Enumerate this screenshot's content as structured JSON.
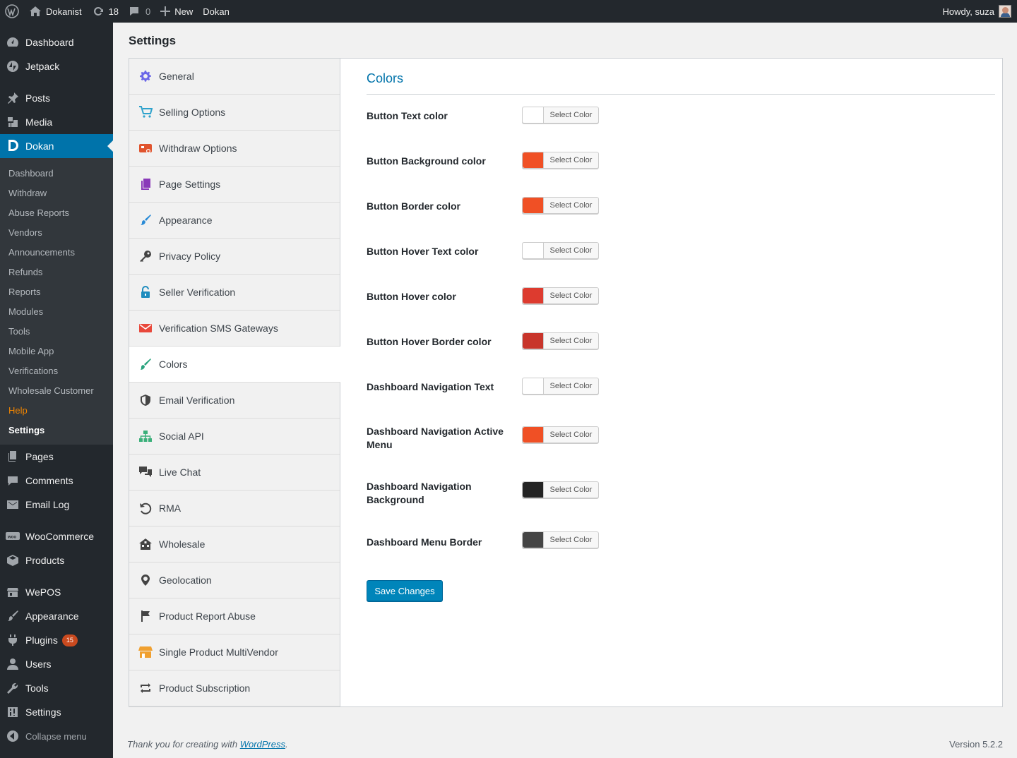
{
  "admin_bar": {
    "site_name": "Dokanist",
    "updates_count": "18",
    "comments_count": "0",
    "new_label": "New",
    "plugin_label": "Dokan",
    "greeting": "Howdy, suza"
  },
  "sidebar": {
    "top_items": [
      {
        "label": "Dashboard",
        "icon": "dashboard-icon"
      },
      {
        "label": "Jetpack",
        "icon": "jetpack-icon"
      },
      {
        "label": "Posts",
        "icon": "pin-icon"
      },
      {
        "label": "Media",
        "icon": "media-icon"
      },
      {
        "label": "Dokan",
        "icon": "dokan-icon"
      }
    ],
    "dokan_submenu": [
      "Dashboard",
      "Withdraw",
      "Abuse Reports",
      "Vendors",
      "Announcements",
      "Refunds",
      "Reports",
      "Modules",
      "Tools",
      "Mobile App",
      "Verifications",
      "Wholesale Customer",
      "Help",
      "Settings"
    ],
    "bottom_items": [
      {
        "label": "Pages",
        "icon": "pages-icon"
      },
      {
        "label": "Comments",
        "icon": "comment-icon"
      },
      {
        "label": "Email Log",
        "icon": "email-icon"
      },
      {
        "label": "WooCommerce",
        "icon": "woo-icon"
      },
      {
        "label": "Products",
        "icon": "box-icon"
      },
      {
        "label": "WePOS",
        "icon": "store-icon"
      },
      {
        "label": "Appearance",
        "icon": "brush-icon"
      },
      {
        "label": "Plugins",
        "icon": "plugin-icon",
        "badge": "15"
      },
      {
        "label": "Users",
        "icon": "user-icon"
      },
      {
        "label": "Tools",
        "icon": "wrench-icon"
      },
      {
        "label": "Settings",
        "icon": "settings-icon"
      }
    ],
    "collapse_label": "Collapse menu"
  },
  "page": {
    "title": "Settings"
  },
  "tabs": [
    {
      "label": "General",
      "icon": "gear-icon",
      "color": "#6b67e8"
    },
    {
      "label": "Selling Options",
      "icon": "cart-icon",
      "color": "#2ea2cc"
    },
    {
      "label": "Withdraw Options",
      "icon": "withdraw-icon",
      "color": "#e0542e"
    },
    {
      "label": "Page Settings",
      "icon": "pages-icon",
      "color": "#8a3ab9"
    },
    {
      "label": "Appearance",
      "icon": "brush-icon",
      "color": "#2a8bd6"
    },
    {
      "label": "Privacy Policy",
      "icon": "key-icon",
      "color": "#444444"
    },
    {
      "label": "Seller Verification",
      "icon": "lock-icon",
      "color": "#1e8cbe"
    },
    {
      "label": "Verification SMS Gateways",
      "icon": "envelope-icon",
      "color": "#e8483b"
    },
    {
      "label": "Colors",
      "icon": "paintbrush-icon",
      "color": "#2aa37e"
    },
    {
      "label": "Email Verification",
      "icon": "shield-icon",
      "color": "#444444"
    },
    {
      "label": "Social API",
      "icon": "network-icon",
      "color": "#3bb07a"
    },
    {
      "label": "Live Chat",
      "icon": "chat-icon",
      "color": "#444444"
    },
    {
      "label": "RMA",
      "icon": "undo-icon",
      "color": "#444444"
    },
    {
      "label": "Wholesale",
      "icon": "wholesale-icon",
      "color": "#444444"
    },
    {
      "label": "Geolocation",
      "icon": "location-icon",
      "color": "#444444"
    },
    {
      "label": "Product Report Abuse",
      "icon": "flag-icon",
      "color": "#444444"
    },
    {
      "label": "Single Product MultiVendor",
      "icon": "shop-icon",
      "color": "#f0a030"
    },
    {
      "label": "Product Subscription",
      "icon": "repeat-icon",
      "color": "#444444"
    }
  ],
  "active_tab": "Colors",
  "colors_section": {
    "title": "Colors",
    "select_label": "Select Color",
    "fields": [
      {
        "label": "Button Text color",
        "color": "#ffffff"
      },
      {
        "label": "Button Background color",
        "color": "#f05025"
      },
      {
        "label": "Button Border color",
        "color": "#f05025"
      },
      {
        "label": "Button Hover Text color",
        "color": "#ffffff"
      },
      {
        "label": "Button Hover color",
        "color": "#dd3b2f"
      },
      {
        "label": "Button Hover Border color",
        "color": "#c8352b"
      },
      {
        "label": "Dashboard Navigation Text",
        "color": "#ffffff"
      },
      {
        "label": "Dashboard Navigation Active Menu",
        "color": "#f05025"
      },
      {
        "label": "Dashboard Navigation Background",
        "color": "#242424"
      },
      {
        "label": "Dashboard Menu Border",
        "color": "#454545"
      }
    ],
    "save_label": "Save Changes"
  },
  "footer": {
    "thanks_prefix": "Thank you for creating with ",
    "thanks_link": "WordPress",
    "thanks_suffix": ".",
    "version": "Version 5.2.2"
  }
}
